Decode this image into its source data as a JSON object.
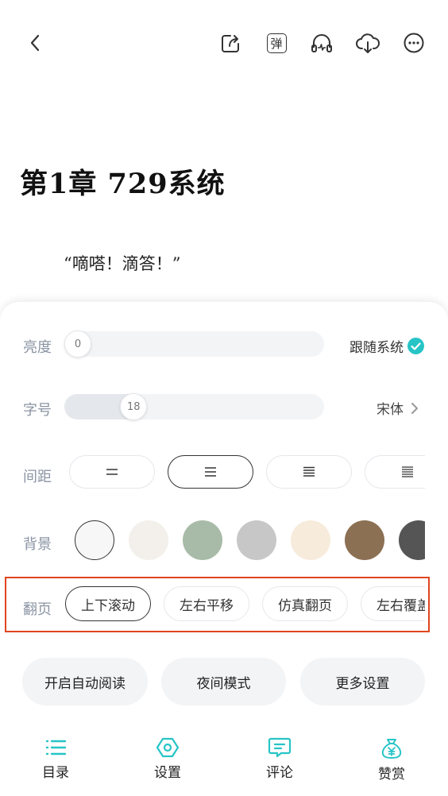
{
  "topbar": {
    "icons": [
      "back-arrow-icon",
      "share-icon",
      "danmaku-icon",
      "headphones-icon",
      "cloud-download-icon",
      "more-icon"
    ],
    "danmaku_glyph": "弹"
  },
  "chapter": {
    "title": "第1章 729系统",
    "text": "“嘀嗒！滴答！”"
  },
  "settings": {
    "brightness": {
      "label": "亮度",
      "value": "0",
      "level": 0,
      "follow_label": "跟随系统",
      "follow_checked": true
    },
    "font_size": {
      "label": "字号",
      "value": "18",
      "level": 0.24,
      "font_label": "宋体"
    },
    "spacing": {
      "label": "间距",
      "options": [
        "compact",
        "normal",
        "loose",
        "looser"
      ],
      "selected": 1
    },
    "background": {
      "label": "背景",
      "colors": [
        "#f7f7f7",
        "#f3f0eb",
        "#a8bba8",
        "#c7c7c7",
        "#f7ebdc",
        "#8c7054",
        "#555555"
      ],
      "selected": 0
    },
    "page_turn": {
      "label": "翻页",
      "options": [
        "上下滚动",
        "左右平移",
        "仿真翻页",
        "左右覆盖"
      ],
      "selected": 0
    }
  },
  "actions": {
    "auto_read": "开启自动阅读",
    "night_mode": "夜间模式",
    "more_settings": "更多设置"
  },
  "bottom_nav": [
    {
      "label": "目录",
      "icon": "list-icon"
    },
    {
      "label": "设置",
      "icon": "settings-icon"
    },
    {
      "label": "评论",
      "icon": "comment-icon"
    },
    {
      "label": "赞赏",
      "icon": "money-bag-icon"
    }
  ],
  "accent_color": "#27c4c6",
  "highlight_color": "#e0451f"
}
